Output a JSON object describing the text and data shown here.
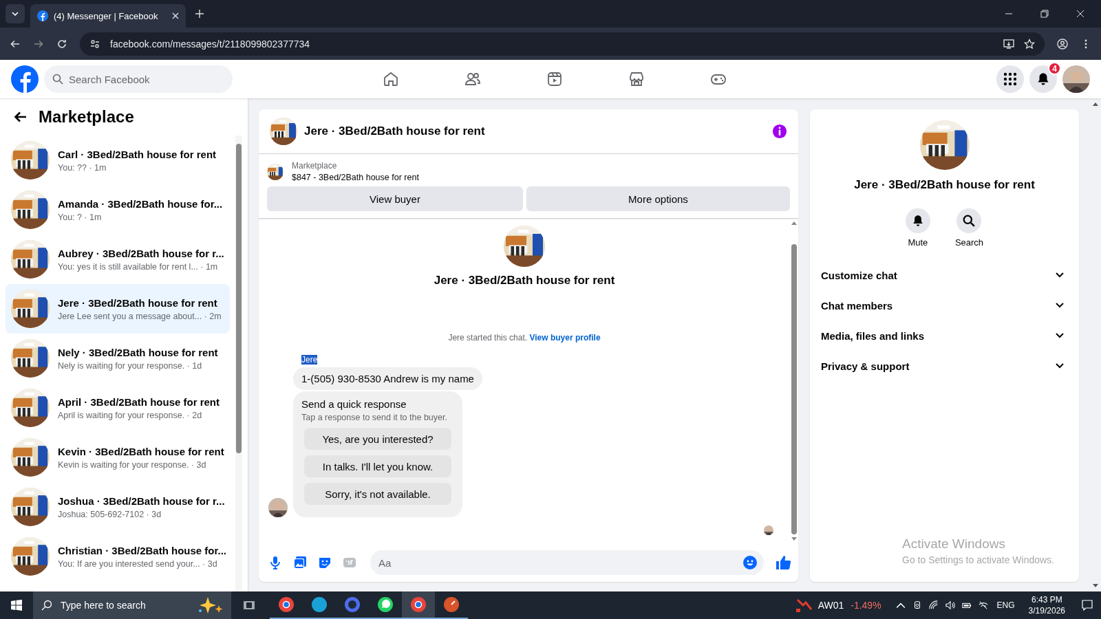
{
  "browser": {
    "tabs": [
      {
        "title": "(4) Messenger | Facebook",
        "selected": true
      }
    ],
    "url": "facebook.com/messages/t/2118099802377734"
  },
  "header": {
    "search_placeholder": "Search Facebook",
    "nav": [
      {
        "kind": "home"
      },
      {
        "kind": "friends"
      },
      {
        "kind": "video"
      },
      {
        "kind": "marketplace"
      },
      {
        "kind": "gaming"
      }
    ],
    "notification_count": "4"
  },
  "sidebar": {
    "title": "Marketplace",
    "conversations": [
      {
        "name": "Carl · 3Bed/2Bath house for rent",
        "preview": "You: ?? · 1m",
        "selected": false
      },
      {
        "name": "Amanda · 3Bed/2Bath house for...",
        "preview": "You: ? · 1m",
        "selected": false
      },
      {
        "name": "Aubrey · 3Bed/2Bath house for r...",
        "preview": "You: yes it is still available for rent l... · 1m",
        "selected": false
      },
      {
        "name": "Jere · 3Bed/2Bath house for rent",
        "preview": "Jere Lee sent you a message about... · 2m",
        "selected": true
      },
      {
        "name": "Nely · 3Bed/2Bath house for rent",
        "preview": "Nely is waiting for your response. · 1d",
        "selected": false
      },
      {
        "name": "April · 3Bed/2Bath house for rent",
        "preview": "April is waiting for your response. · 2d",
        "selected": false
      },
      {
        "name": "Kevin · 3Bed/2Bath house for rent",
        "preview": "Kevin is waiting for your response. · 3d",
        "selected": false
      },
      {
        "name": "Joshua · 3Bed/2Bath house for r...",
        "preview": "Joshua: 505-692-7102 · 3d",
        "selected": false
      },
      {
        "name": "Christian · 3Bed/2Bath house for...",
        "preview": "You: If are you interested send your... · 3d",
        "selected": false
      }
    ]
  },
  "chat": {
    "title": "Jere · 3Bed/2Bath house for rent",
    "listing": {
      "source": "Marketplace",
      "text": "$847 - 3Bed/2Bath house for rent"
    },
    "buttons": [
      "View buyer",
      "More options"
    ],
    "intro_name": "Jere · 3Bed/2Bath house for rent",
    "started_text": "Jere started this chat.",
    "profile_link": "View buyer profile",
    "sender": "Jere",
    "message": "1-(505) 930-8530 Andrew is my name",
    "quick_response": {
      "title": "Send a quick response",
      "subtitle": "Tap a response to send it to the buyer.",
      "options": [
        "Yes, are you interested?",
        "In talks. I'll let you know.",
        "Sorry, it's not available."
      ]
    },
    "composer_placeholder": "Aa"
  },
  "details": {
    "title": "Jere · 3Bed/2Bath house for rent",
    "actions": [
      {
        "kind": "mute",
        "label": "Mute"
      },
      {
        "kind": "search",
        "label": "Search"
      }
    ],
    "sections": [
      {
        "label": "Customize chat",
        "expanded": false
      },
      {
        "label": "Chat members",
        "expanded": false
      },
      {
        "label": "Media, files and links",
        "expanded": false
      },
      {
        "label": "Privacy & support",
        "expanded": false
      }
    ]
  },
  "watermark": {
    "title": "Activate Windows",
    "text": "Go to Settings to activate Windows."
  },
  "taskbar": {
    "search_placeholder": "Type here to search",
    "apps": [
      {
        "kind": "chrome",
        "selected": false
      },
      {
        "kind": "edge",
        "selected": false
      },
      {
        "kind": "ring",
        "selected": false
      },
      {
        "kind": "whatsapp",
        "selected": false
      },
      {
        "kind": "chrome",
        "selected": true
      },
      {
        "kind": "gauge",
        "selected": false
      }
    ],
    "stock": {
      "symbol": "AW01",
      "change": "-1.49%"
    },
    "language": "ENG",
    "time": "6:43 PM",
    "date": "3/19/2026"
  }
}
